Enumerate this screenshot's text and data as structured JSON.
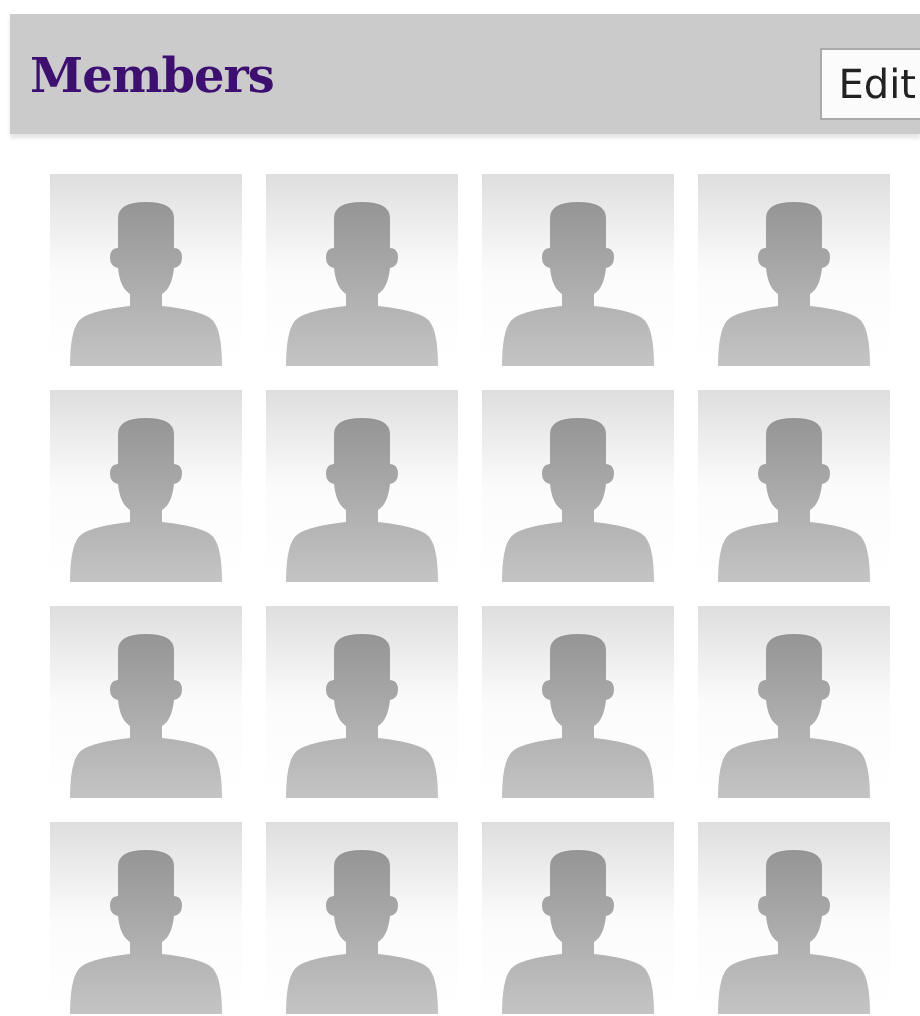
{
  "panel": {
    "title": "Members",
    "edit_button": "Edit"
  },
  "members": [
    {
      "kind": "avatar"
    },
    {
      "kind": "avatar"
    },
    {
      "kind": "avatar"
    },
    {
      "kind": "avatar"
    },
    {
      "kind": "avatar"
    },
    {
      "kind": "avatar"
    },
    {
      "kind": "avatar"
    },
    {
      "kind": "avatar"
    },
    {
      "kind": "avatar"
    },
    {
      "kind": "avatar"
    },
    {
      "kind": "avatar"
    },
    {
      "kind": "avatar"
    },
    {
      "kind": "avatar"
    },
    {
      "kind": "avatar"
    },
    {
      "kind": "avatar"
    },
    {
      "kind": "avatar"
    }
  ]
}
